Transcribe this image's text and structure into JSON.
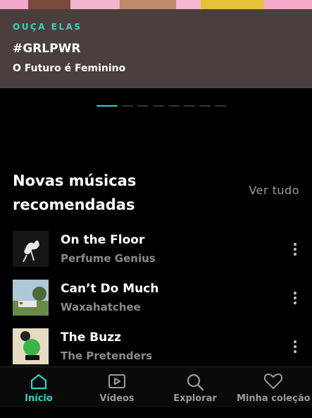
{
  "hero": {
    "kicker": "OUÇA ELAS",
    "title": "#GRLPWR",
    "subtitle": "O Futuro é Feminino"
  },
  "carousel": {
    "total_pages": 8,
    "active_index": 0
  },
  "section": {
    "title": "Novas músicas recomendadas",
    "see_all_label": "Ver tudo"
  },
  "tracks": [
    {
      "title": "On the Floor",
      "artist": "Perfume Genius"
    },
    {
      "title": "Can’t Do Much",
      "artist": "Waxahatchee"
    },
    {
      "title": "The Buzz",
      "artist": "The Pretenders"
    }
  ],
  "nav": {
    "items": [
      {
        "label": "Início",
        "icon": "home-icon",
        "active": true
      },
      {
        "label": "Vídeos",
        "icon": "video-icon",
        "active": false
      },
      {
        "label": "Explorar",
        "icon": "search-icon",
        "active": false
      },
      {
        "label": "Minha coleção",
        "icon": "heart-icon",
        "active": false
      }
    ]
  },
  "colors": {
    "accent": "#2fd3c8",
    "background": "#000000",
    "hero_bg": "#4a3f3c",
    "muted_text": "#8a8a8a"
  }
}
